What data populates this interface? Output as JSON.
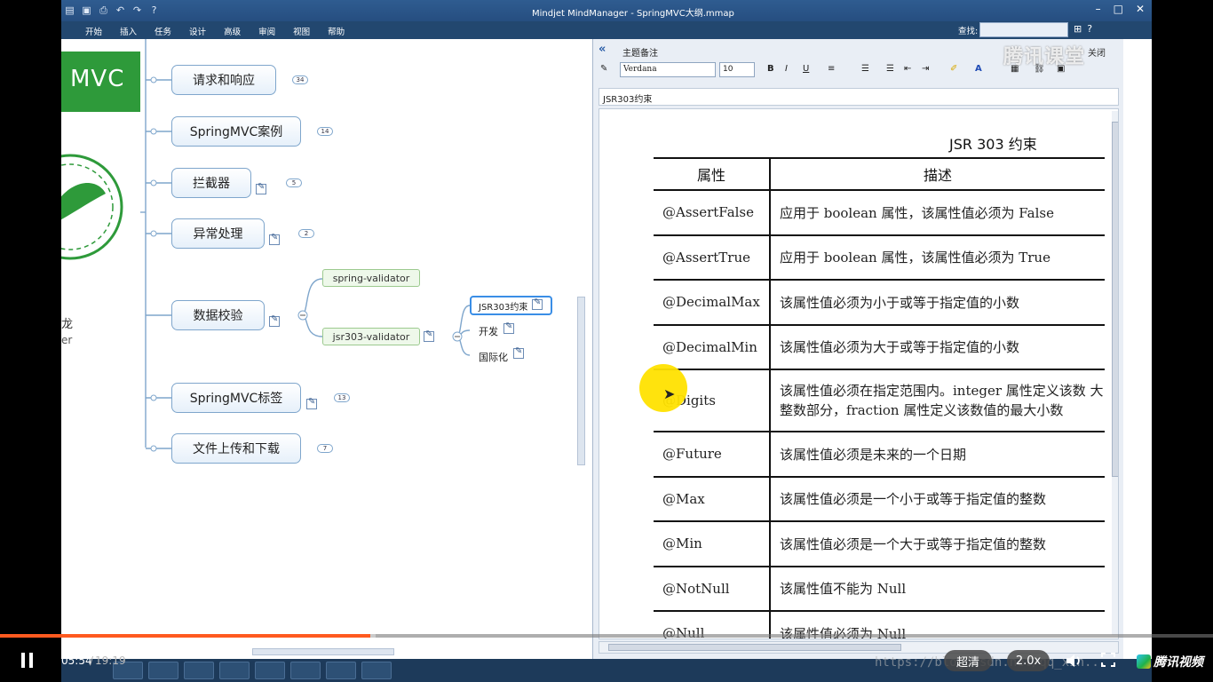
{
  "window": {
    "title": "Mindjet MindManager - SpringMVC大纲.mmap"
  },
  "ribbon": {
    "tabs": [
      "开始",
      "插入",
      "任务",
      "设计",
      "高级",
      "审阅",
      "视图",
      "帮助"
    ],
    "find_label": "查找:"
  },
  "map": {
    "logo_text": "MVC",
    "author_line1": "龙",
    "author_line2": "er",
    "topics": [
      {
        "label": "请求和响应",
        "count": "34"
      },
      {
        "label": "SpringMVC案例",
        "count": "14"
      },
      {
        "label": "拦截器",
        "count": "5"
      },
      {
        "label": "异常处理",
        "count": "2"
      },
      {
        "label": "数据校验"
      },
      {
        "label": "SpringMVC标签",
        "count": "13"
      },
      {
        "label": "文件上传和下载",
        "count": "7"
      }
    ],
    "subtopics": [
      "spring-validator",
      "jsr303-validator"
    ],
    "leaves": [
      "JSR303约束",
      "开发",
      "国际化"
    ]
  },
  "notes": {
    "title": "主题备注",
    "close_label": "关闭",
    "font_name": "Verdana",
    "font_size": "10",
    "subject": "JSR303约束",
    "doc_title": "JSR 303 约束",
    "table_headers": [
      "属性",
      "描述"
    ],
    "table_rows": [
      {
        "attr": "@AssertFalse",
        "desc": "应用于 boolean 属性，该属性值必须为 False"
      },
      {
        "attr": "@AssertTrue",
        "desc": "应用于 boolean 属性，该属性值必须为 True"
      },
      {
        "attr": "@DecimalMax",
        "desc": "该属性值必须为小于或等于指定值的小数"
      },
      {
        "attr": "@DecimalMin",
        "desc": "该属性值必须为大于或等于指定值的小数"
      },
      {
        "attr": "@Digits",
        "desc": "该属性值必须在指定范围内。integer 属性定义该数 大整数部分，fraction 属性定义该数值的最大小数"
      },
      {
        "attr": "@Future",
        "desc": "该属性值必须是未来的一个日期"
      },
      {
        "attr": "@Max",
        "desc": "该属性值必须是一个小于或等于指定值的整数"
      },
      {
        "attr": "@Min",
        "desc": "该属性值必须是一个大于或等于指定值的整数"
      },
      {
        "attr": "@NotNull",
        "desc": "该属性值不能为 Null"
      },
      {
        "attr": "@Null",
        "desc": "该属性值必须为 Null"
      }
    ]
  },
  "watermark": {
    "top": "腾讯课堂",
    "url": "https://blog.csdn.net/qq_xin..."
  },
  "player": {
    "time_current": "05:54",
    "time_separator": "/",
    "time_total": "19:19",
    "progress_fraction": 0.305,
    "buffer_fraction": 0.31,
    "quality_label": "超清",
    "speed_label": "2.0x",
    "brand": "腾讯视频",
    "accent_color": "#ff5a1f"
  }
}
